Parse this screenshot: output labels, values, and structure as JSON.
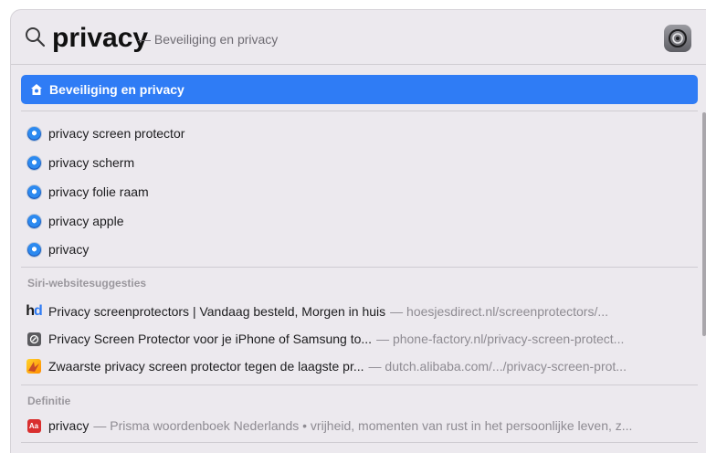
{
  "search": {
    "query": "privacy",
    "completion": "— Beveiliging en privacy"
  },
  "top_hit": {
    "label": "Beveiliging en privacy",
    "icon": "shield-house-icon"
  },
  "suggestions": [
    {
      "label": "privacy screen protector",
      "icon": "safari-icon"
    },
    {
      "label": "privacy scherm",
      "icon": "safari-icon"
    },
    {
      "label": "privacy folie raam",
      "icon": "safari-icon"
    },
    {
      "label": "privacy apple",
      "icon": "safari-icon"
    },
    {
      "label": "privacy",
      "icon": "safari-icon"
    }
  ],
  "siri_section": {
    "header": "Siri-websitesuggesties",
    "items": [
      {
        "title": "Privacy screenprotectors | Vandaag besteld, Morgen in huis",
        "url": "— hoesjesdirect.nl/screenprotectors/...",
        "icon": "hd-logo-icon"
      },
      {
        "title": "Privacy Screen Protector voor je iPhone of Samsung to...",
        "url": "— phone-factory.nl/privacy-screen-protect...",
        "icon": "phone-factory-icon"
      },
      {
        "title": "Zwaarste privacy screen protector tegen de laagste pr...",
        "url": "— dutch.alibaba.com/.../privacy-screen-prot...",
        "icon": "alibaba-icon"
      }
    ]
  },
  "definition_section": {
    "header": "Definitie",
    "item": {
      "title": "privacy",
      "detail": "— Prisma woordenboek Nederlands • vrijheid, momenten van rust in het persoonlijke leven, z...",
      "icon": "dictionary-icon"
    }
  },
  "colors": {
    "selection": "#2f7cf5",
    "panel_background": "#ece9ee"
  }
}
